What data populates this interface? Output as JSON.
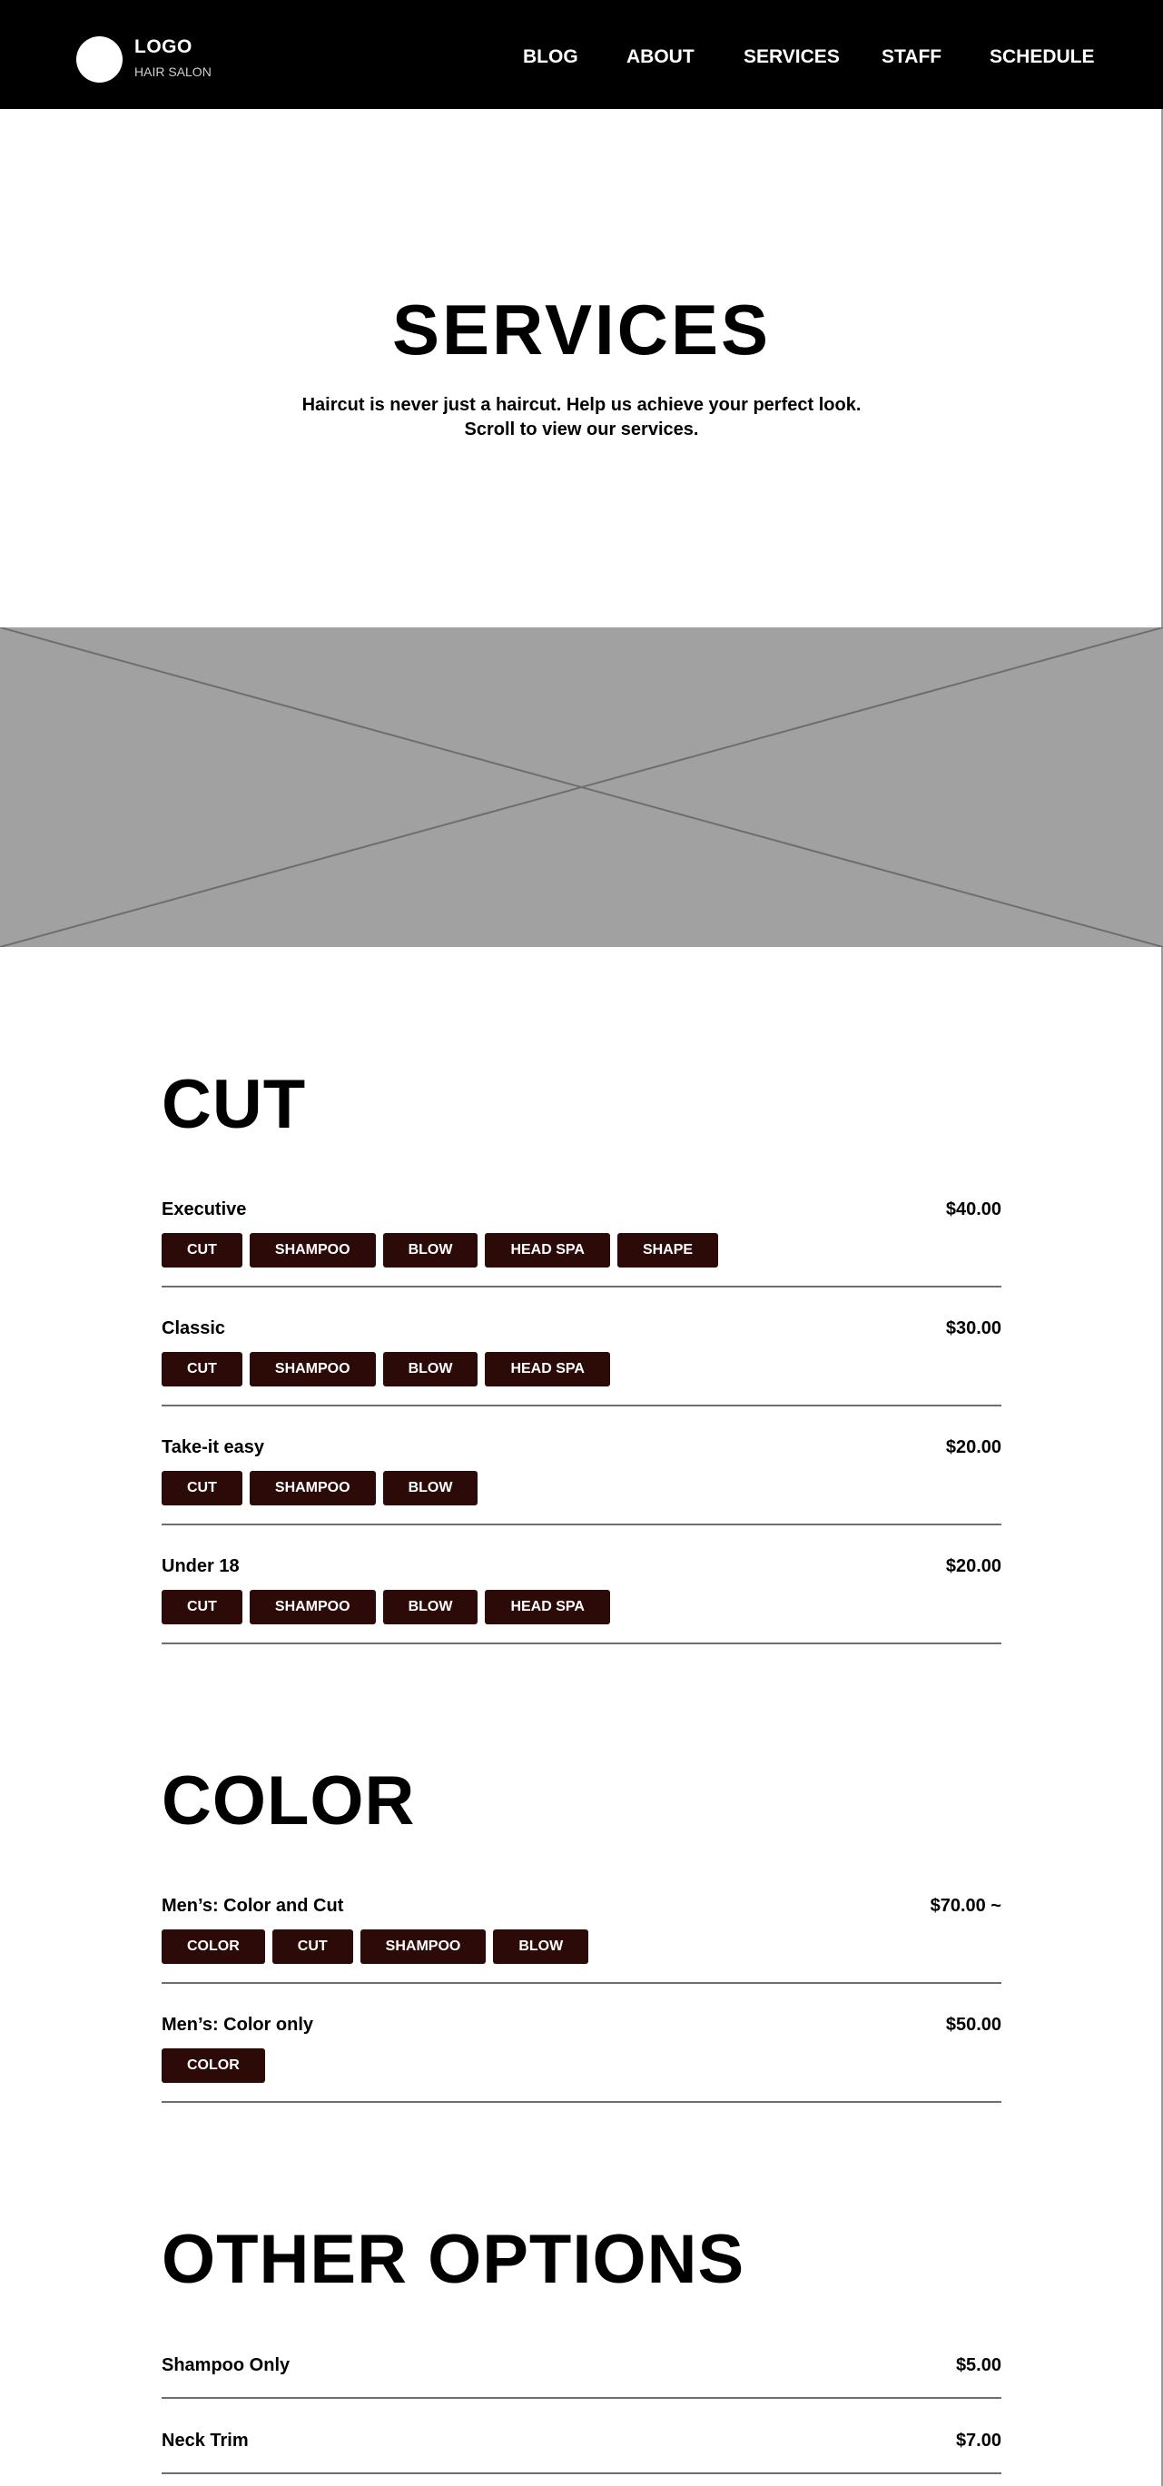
{
  "header": {
    "logo_title": "LOGO",
    "logo_subtitle": "HAIR SALON",
    "nav": [
      "BLOG",
      "ABOUT",
      "SERVICES",
      "STAFF",
      "SCHEDULE"
    ]
  },
  "hero": {
    "title": "SERVICES",
    "subtitle_line1": "Haircut is never just a haircut. Help us achieve your perfect look.",
    "subtitle_line2": "Scroll to view our services."
  },
  "cut": {
    "title": "CUT",
    "items": [
      {
        "name": "Executive",
        "price": "$40.00",
        "tags": [
          "CUT",
          "SHAMPOO",
          "BLOW",
          "HEAD SPA",
          "SHAPE"
        ]
      },
      {
        "name": "Classic",
        "price": "$30.00",
        "tags": [
          "CUT",
          "SHAMPOO",
          "BLOW",
          "HEAD SPA"
        ]
      },
      {
        "name": "Take-it easy",
        "price": "$20.00",
        "tags": [
          "CUT",
          "SHAMPOO",
          "BLOW"
        ]
      },
      {
        "name": "Under 18",
        "price": "$20.00",
        "tags": [
          "CUT",
          "SHAMPOO",
          "BLOW",
          "HEAD SPA"
        ]
      }
    ]
  },
  "color": {
    "title": "COLOR",
    "items": [
      {
        "name": "Men’s: Color and Cut",
        "price": "$70.00 ~",
        "tags": [
          "COLOR",
          "CUT",
          "SHAMPOO",
          "BLOW"
        ]
      },
      {
        "name": "Men’s: Color only",
        "price": "$50.00",
        "tags": [
          "COLOR"
        ]
      }
    ]
  },
  "other": {
    "title": "OTHER OPTIONS",
    "items": [
      {
        "name": "Shampoo Only",
        "price": "$5.00"
      },
      {
        "name": "Neck Trim",
        "price": "$7.00"
      }
    ]
  },
  "colors": {
    "header_bg": "#000000",
    "tag_bg": "#2b0a08",
    "placeholder_bg": "#a1a1a1",
    "divider": "#6e6e6e"
  }
}
